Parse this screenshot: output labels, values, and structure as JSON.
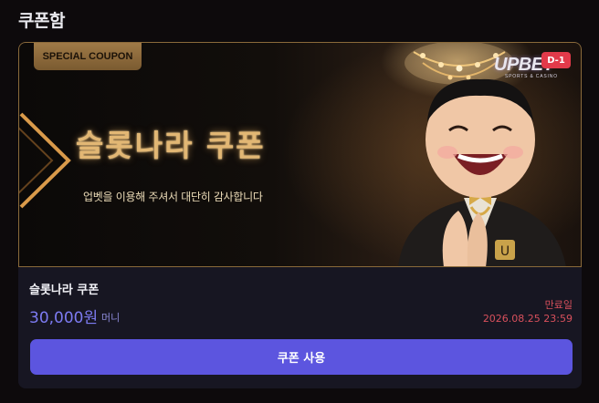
{
  "page": {
    "title": "쿠폰함"
  },
  "coupon": {
    "banner": {
      "tag": "SPECIAL COUPON",
      "title": "슬롯나라 쿠폰",
      "subtitle": "업벳을 이용해 주셔서 대단히 감사합니다",
      "logo_main": "UPBET",
      "logo_sub": "SPORTS & CASINO",
      "dday": "D-1"
    },
    "name": "슬롯나라 쿠폰",
    "amount": "30,000원",
    "currency": "머니",
    "expiry_label": "만료일",
    "expiry_date": "2026.08.25 23:59",
    "use_button": "쿠폰 사용"
  },
  "colors": {
    "background": "#0d0a0c",
    "accent": "#5c55df",
    "amount": "#7d7bf2",
    "expiry": "#d8505c",
    "gold": "#e2b774"
  }
}
